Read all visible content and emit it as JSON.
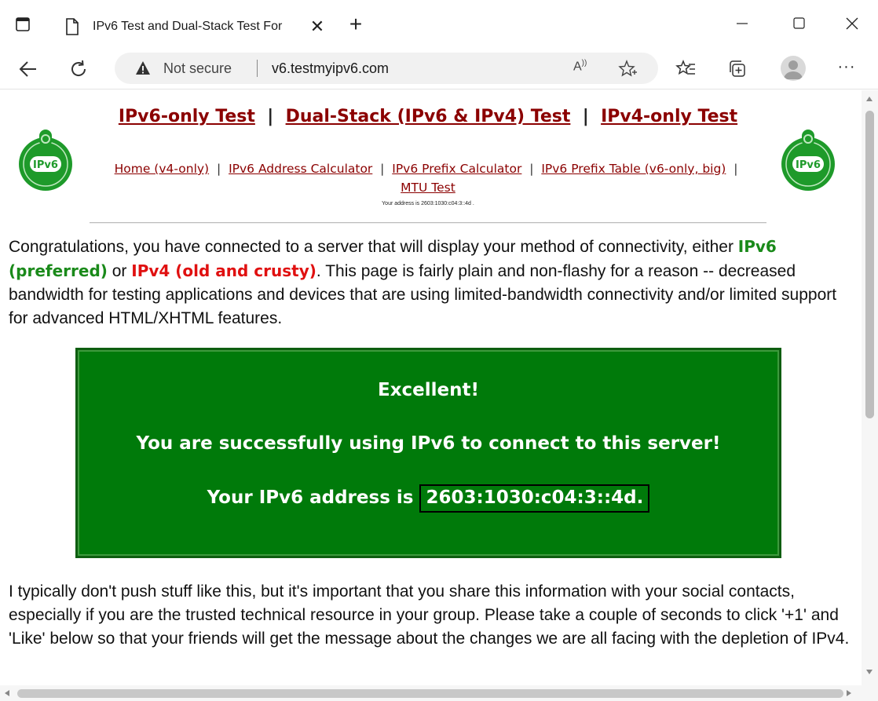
{
  "window": {
    "tab_title": "IPv6 Test and Dual-Stack Test For",
    "tab_close": "✕",
    "new_tab": "+",
    "minimize": "—",
    "close": "✕"
  },
  "toolbar": {
    "not_secure": "Not secure",
    "url": "v6.testmyipv6.com",
    "read_aloud": "A",
    "menu": "···"
  },
  "icons": {
    "tab_actions": "window-icon",
    "page": "page-icon",
    "back": "back-arrow-icon",
    "reload": "reload-icon",
    "warning": "warning-icon",
    "favorites_add": "star-plus-icon",
    "favorites": "favorites-icon",
    "collections": "collections-icon",
    "profile": "profile-icon",
    "badge": "ipv6-ready-badge-icon"
  },
  "header": {
    "link_ipv6_only": "IPv6-only Test",
    "sep1": "|",
    "link_dual_stack": "Dual-Stack (IPv6 & IPv4) Test",
    "sep2": "|",
    "link_ipv4_only": "IPv4-only Test",
    "sub_home": "Home (v4-only)",
    "sub_addr_calc": "IPv6 Address Calculator",
    "sub_prefix_calc": "IPv6 Prefix Calculator",
    "sub_prefix_table": "IPv6 Prefix Table (v6-only, big)",
    "sub_mtu": "MTU Test",
    "sub_sep": "|",
    "address_small": "Your address is 2603:1030:c04:3::4d ."
  },
  "intro": {
    "part1": "Congratulations, you have connected to a server that will display your method of connectivity, either ",
    "ipv6": "IPv6 (preferred)",
    "or": " or ",
    "ipv4": "IPv4 (old and crusty)",
    "part2": ". This page is fairly plain and non-flashy for a reason -- decreased bandwidth for testing applications and devices that are using limited-bandwidth connectivity and/or limited support for advanced HTML/XHTML features."
  },
  "result": {
    "line1": "Excellent!",
    "line2": "You are successfully using IPv6 to connect to this server!",
    "line3_prefix": "Your IPv6 address is",
    "address": "2603:1030:c04:3::4d."
  },
  "outro": {
    "text": "I typically don't push stuff like this, but it's important that you share this information with your social contacts, especially if you are the trusted technical resource in your group. Please take a couple of seconds to click '+1' and 'Like' below so that your friends will get the message about the changes we are all facing with the depletion of IPv4."
  },
  "colors": {
    "link": "#8b0000",
    "result_bg": "#007a0a",
    "ipv6_green": "#1a8a1a",
    "ipv4_red": "#e01010"
  }
}
